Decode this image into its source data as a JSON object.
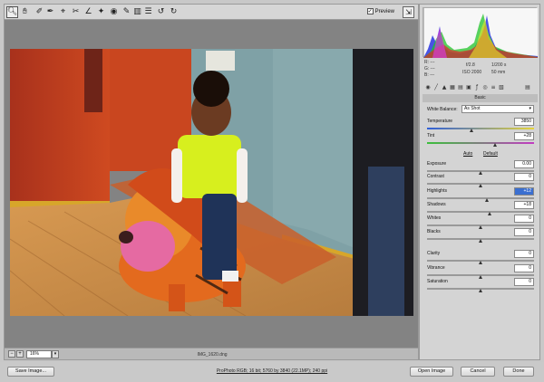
{
  "toolbar": {
    "tools": [
      "zoom-tool",
      "hand-tool",
      "white-balance-tool",
      "color-sampler-tool",
      "targeted-adjustment-tool",
      "crop-tool",
      "straighten-tool",
      "spot-removal-tool",
      "red-eye-tool",
      "adjustment-brush",
      "graduated-filter",
      "preferences",
      "rotate-ccw",
      "rotate-cw"
    ],
    "preview_label": "Preview",
    "preview_checked": true
  },
  "canvas": {
    "zoom_value": "16%",
    "filename": "IMG_1620.dng"
  },
  "readout": {
    "r_label": "R:",
    "r_value": "---",
    "g_label": "G:",
    "g_value": "---",
    "b_label": "B:",
    "b_value": "---",
    "aperture": "f/2.8",
    "shutter": "1/200 s",
    "iso": "ISO 2000",
    "focal": "50 mm"
  },
  "panel": {
    "section_title": "Basic",
    "white_balance_label": "White Balance:",
    "white_balance_value": "As Shot",
    "auto_label": "Auto",
    "default_label": "Default",
    "sliders": [
      {
        "label": "Temperature",
        "value": "3850",
        "pos": 0.42,
        "kind": "temp"
      },
      {
        "label": "Tint",
        "value": "+28",
        "pos": 0.64,
        "kind": "tint"
      },
      {
        "label": "Exposure",
        "value": "0.00",
        "pos": 0.5,
        "kind": "plain"
      },
      {
        "label": "Contrast",
        "value": "0",
        "pos": 0.5,
        "kind": "plain"
      },
      {
        "label": "Highlights",
        "value": "+12",
        "pos": 0.56,
        "kind": "plain",
        "selected": true
      },
      {
        "label": "Shadows",
        "value": "+18",
        "pos": 0.59,
        "kind": "plain"
      },
      {
        "label": "Whites",
        "value": "0",
        "pos": 0.5,
        "kind": "plain"
      },
      {
        "label": "Blacks",
        "value": "0",
        "pos": 0.5,
        "kind": "plain"
      },
      {
        "label": "Clarity",
        "value": "0",
        "pos": 0.5,
        "kind": "plain"
      },
      {
        "label": "Vibrance",
        "value": "0",
        "pos": 0.5,
        "kind": "plain"
      },
      {
        "label": "Saturation",
        "value": "0",
        "pos": 0.5,
        "kind": "plain"
      }
    ]
  },
  "footer": {
    "save_label": "Save Image...",
    "workflow_label": "ProPhoto RGB; 16 bit; 5760 by 3840 (22.1MP); 240 ppi",
    "open_label": "Open Image",
    "cancel_label": "Cancel",
    "done_label": "Done"
  }
}
